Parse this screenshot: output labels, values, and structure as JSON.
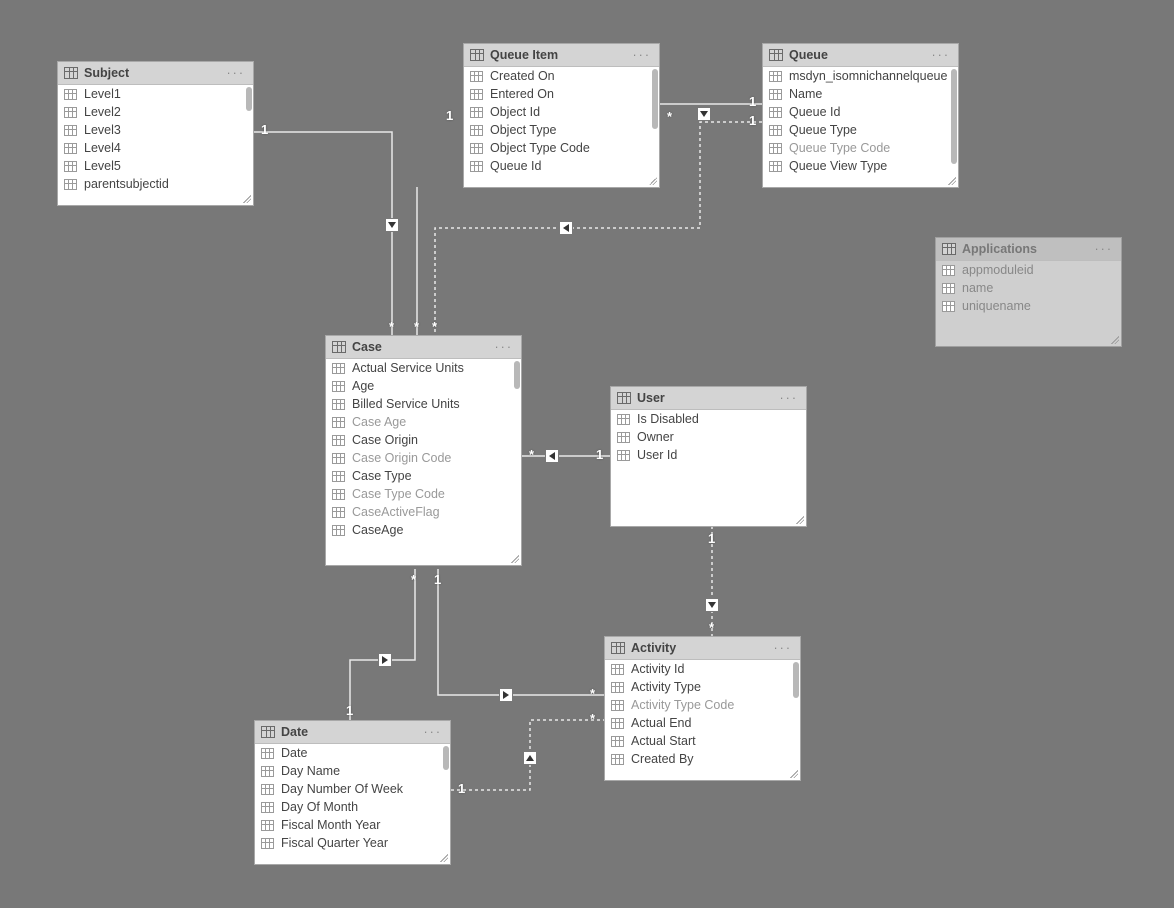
{
  "entities": {
    "subject": {
      "title": "Subject",
      "fields": [
        {
          "label": "Level1"
        },
        {
          "label": "Level2"
        },
        {
          "label": "Level3"
        },
        {
          "label": "Level4"
        },
        {
          "label": "Level5"
        },
        {
          "label": "parentsubjectid"
        }
      ]
    },
    "queueItem": {
      "title": "Queue Item",
      "fields": [
        {
          "label": "Created On"
        },
        {
          "label": "Entered On"
        },
        {
          "label": "Object Id"
        },
        {
          "label": "Object Type"
        },
        {
          "label": "Object Type Code"
        },
        {
          "label": "Queue Id"
        }
      ]
    },
    "queue": {
      "title": "Queue",
      "fields": [
        {
          "label": "msdyn_isomnichannelqueue"
        },
        {
          "label": "Name"
        },
        {
          "label": "Queue Id"
        },
        {
          "label": "Queue Type"
        },
        {
          "label": "Queue Type Code",
          "dimmed": true
        },
        {
          "label": "Queue View Type"
        }
      ]
    },
    "applications": {
      "title": "Applications",
      "fields": [
        {
          "label": "appmoduleid"
        },
        {
          "label": "name"
        },
        {
          "label": "uniquename"
        }
      ]
    },
    "case": {
      "title": "Case",
      "fields": [
        {
          "label": "Actual Service Units"
        },
        {
          "label": "Age"
        },
        {
          "label": "Billed Service Units"
        },
        {
          "label": "Case Age",
          "dimmed": true
        },
        {
          "label": "Case Origin"
        },
        {
          "label": "Case Origin Code",
          "dimmed": true
        },
        {
          "label": "Case Type"
        },
        {
          "label": "Case Type Code",
          "dimmed": true
        },
        {
          "label": "CaseActiveFlag",
          "dimmed": true
        },
        {
          "label": "CaseAge"
        }
      ]
    },
    "user": {
      "title": "User",
      "fields": [
        {
          "label": "Is Disabled"
        },
        {
          "label": "Owner"
        },
        {
          "label": "User Id"
        }
      ]
    },
    "activity": {
      "title": "Activity",
      "fields": [
        {
          "label": "Activity Id"
        },
        {
          "label": "Activity Type"
        },
        {
          "label": "Activity Type Code",
          "dimmed": true
        },
        {
          "label": "Actual End"
        },
        {
          "label": "Actual Start"
        },
        {
          "label": "Created By"
        }
      ]
    },
    "date": {
      "title": "Date",
      "fields": [
        {
          "label": "Date"
        },
        {
          "label": "Day Name"
        },
        {
          "label": "Day Number Of Week"
        },
        {
          "label": "Day Of Month"
        },
        {
          "label": "Fiscal Month Year"
        },
        {
          "label": "Fiscal Quarter Year"
        }
      ]
    }
  },
  "cardinalities": {
    "one": "1",
    "many": "*"
  },
  "menu_dots": "···"
}
